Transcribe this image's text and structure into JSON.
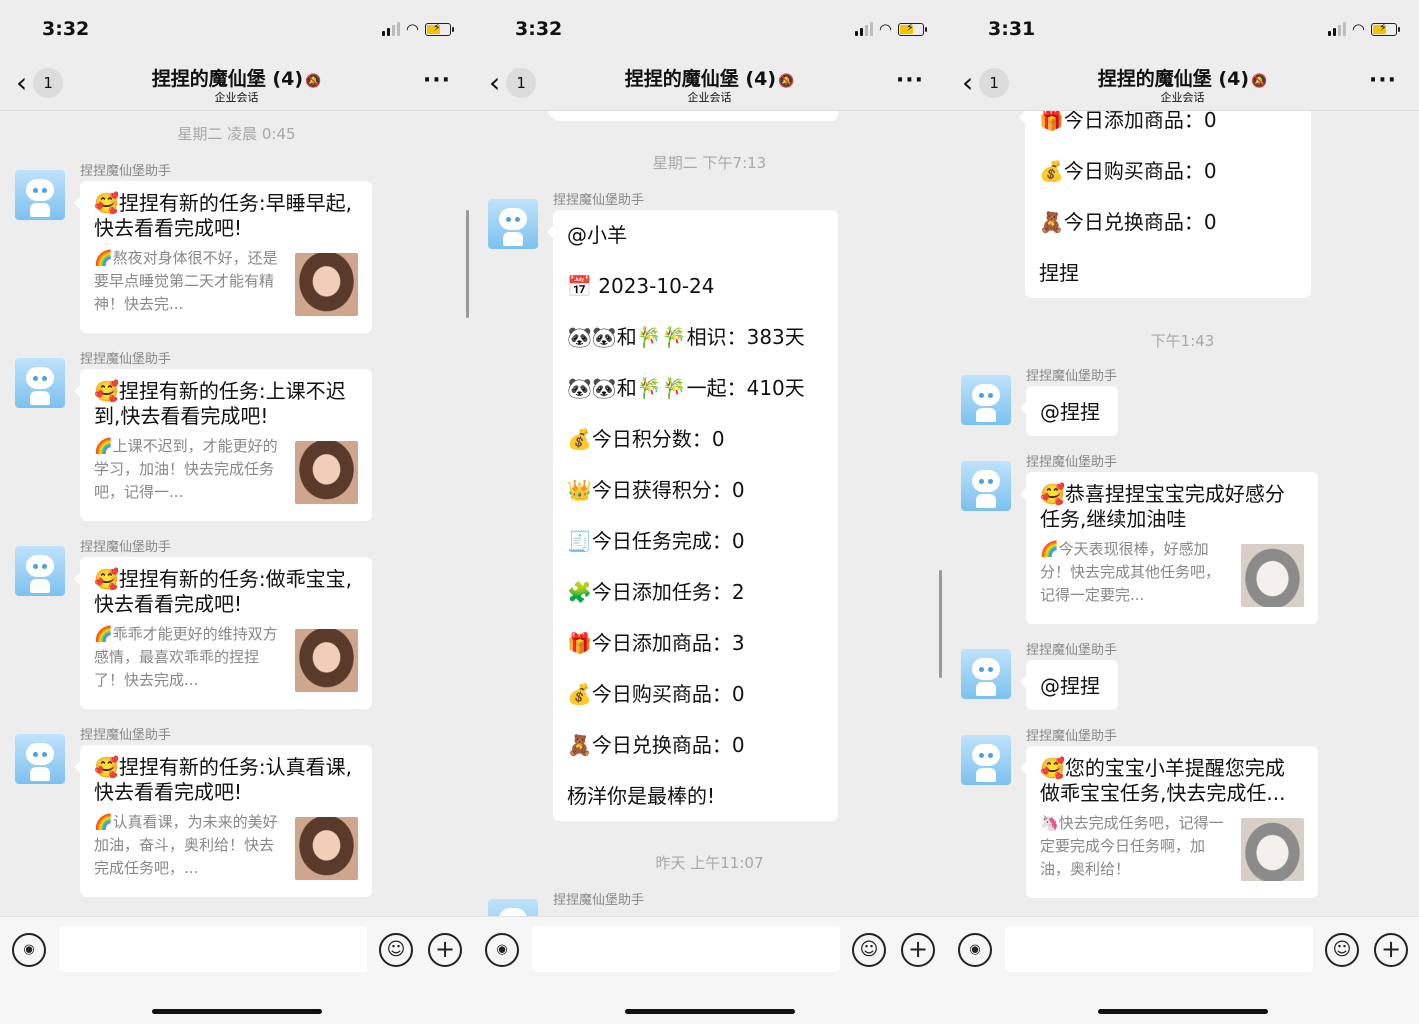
{
  "header": {
    "title": "捏捏的魔仙堡 (4)",
    "mute_icon": "🔕",
    "subtitle": "企业会话",
    "back_count": "1",
    "more": "···"
  },
  "sender": "捏捏魔仙堡助手",
  "phones": [
    {
      "time": "3:32",
      "timestamp": "星期二 凌晨 0:45",
      "cards": [
        {
          "title": "🥰捏捏有新的任务:早睡早起,快去看看完成吧!",
          "desc": "🌈熬夜对身体很不好，还是要早点睡觉第二天才能有精神！快去完...",
          "thumb": "girl-photo"
        },
        {
          "title": "🥰捏捏有新的任务:上课不迟到,快去看看完成吧!",
          "desc": "🌈上课不迟到，才能更好的学习，加油！快去完成任务吧，记得一...",
          "thumb": "girl-photo"
        },
        {
          "title": "🥰捏捏有新的任务:做乖宝宝,快去看看完成吧!",
          "desc": "🌈乖乖才能更好的维持双方感情，最喜欢乖乖的捏捏了！快去完成...",
          "thumb": "girl-photo"
        },
        {
          "title": "🥰捏捏有新的任务:认真看课,快去看看完成吧!",
          "desc": "🌈认真看课，为未来的美好加油，奋斗，奥利给！快去完成任务吧，...",
          "thumb": "girl-photo"
        }
      ]
    },
    {
      "time": "3:32",
      "timestamp": "星期二 下午7:13",
      "timestamp2": "昨天 上午11:07",
      "lines": [
        "@小羊",
        "📅 2023-10-24",
        "🐼🐼和🎋🎋相识：383天",
        "🐼🐼和🎋🎋一起：410天",
        "💰今日积分数：0",
        "👑今日获得积分：0",
        "🧾今日任务完成：0",
        "🧩今日添加任务：2",
        "🎁今日添加商品：3",
        "💰今日购买商品：0",
        "🧸今日兑换商品：0",
        "杨洋你是最棒的!"
      ]
    },
    {
      "time": "3:31",
      "timestamp": "下午1:43",
      "lines": [
        "🎁今日添加商品：0",
        "💰今日购买商品：0",
        "🧸今日兑换商品：0",
        "捏捏"
      ],
      "mention": "@捏捏",
      "cards": [
        {
          "title": "🥰恭喜捏捏宝宝完成好感分任务,继续加油哇",
          "desc": "🌈今天表现很棒，好感加分！快去完成其他任务吧，记得一定要完...",
          "thumb": "cat-photo"
        },
        {
          "title": "🥰您的宝宝小羊提醒您完成做乖宝宝任务,快去完成任...",
          "desc": "🦄快去完成任务吧，记得一定要完成今日任务啊，加油，奥利给！",
          "thumb": "cat-photo"
        }
      ]
    }
  ]
}
